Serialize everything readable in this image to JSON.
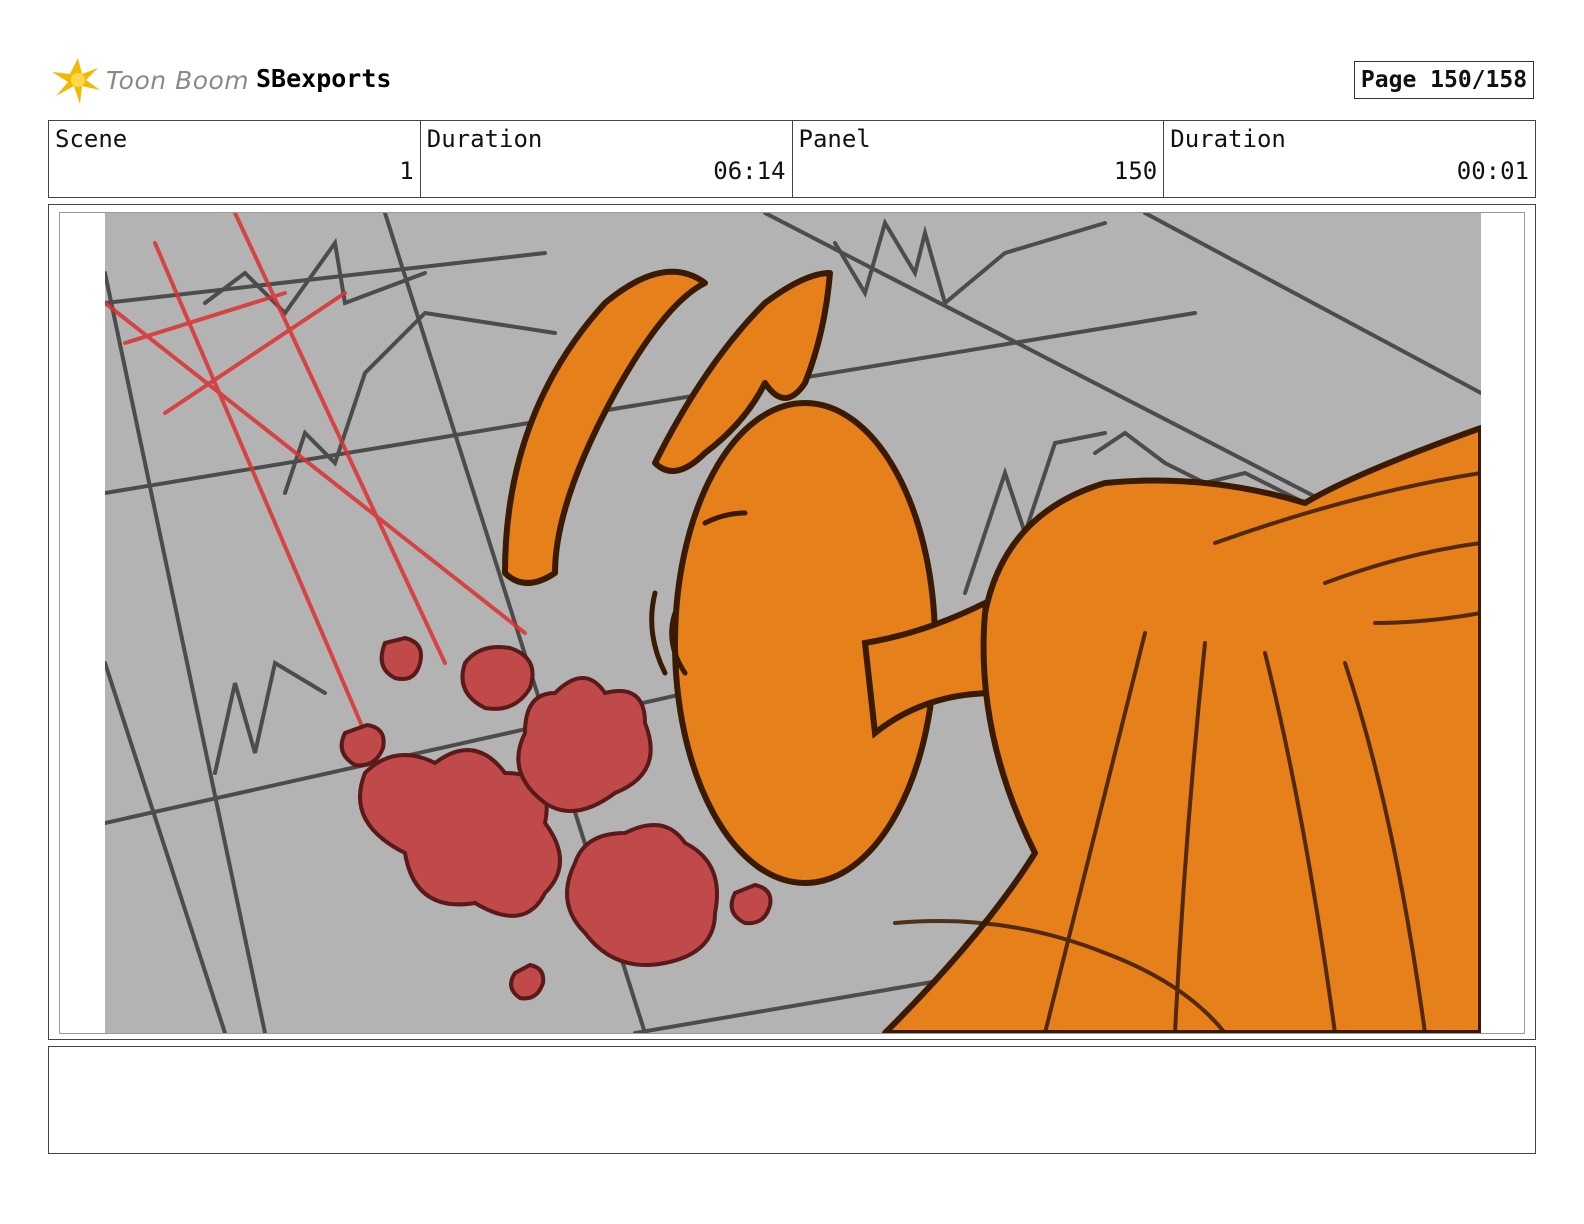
{
  "header": {
    "logo_text": "Toon Boom",
    "project_name": "SBexports",
    "page_label": "Page 150/158"
  },
  "info": [
    {
      "label": "Scene",
      "value": "1"
    },
    {
      "label": "Duration",
      "value": "06:14"
    },
    {
      "label": "Panel",
      "value": "150"
    },
    {
      "label": "Duration",
      "value": "00:01"
    }
  ],
  "panel": {
    "background_color": "#b3b3b3",
    "character_color": "#e5801a",
    "dust_color": "#c04a4a",
    "motion_line_color": "#dd3030",
    "sketch_line_color": "#333333"
  },
  "notes": {
    "text": ""
  }
}
